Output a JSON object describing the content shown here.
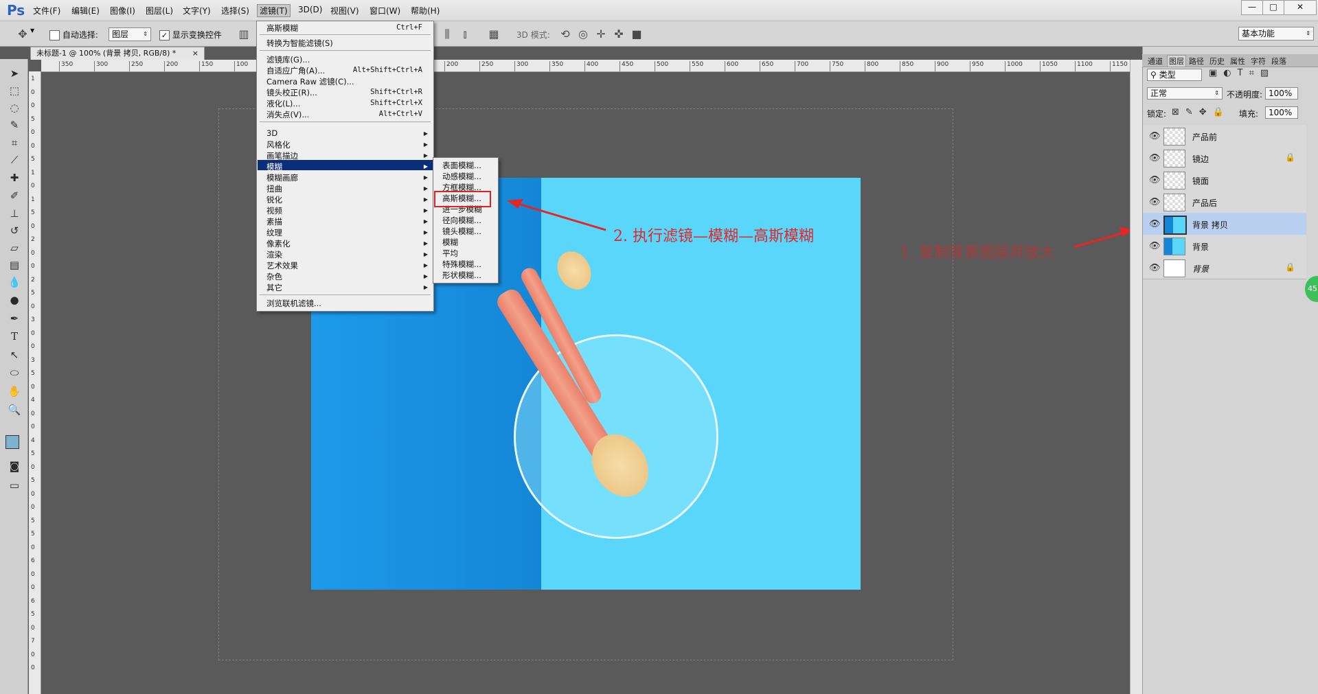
{
  "app": {
    "logo": "Ps",
    "workspace": "基本功能"
  },
  "menubar": {
    "items": [
      "文件(F)",
      "编辑(E)",
      "图像(I)",
      "图层(L)",
      "文字(Y)",
      "选择(S)",
      "滤镜(T)",
      "3D(D)",
      "视图(V)",
      "窗口(W)",
      "帮助(H)"
    ],
    "active": "滤镜(T)"
  },
  "window_controls": {
    "minimize": "—",
    "maximize": "□",
    "close": "✕"
  },
  "options": {
    "auto_select_label": "自动选择:",
    "auto_select_value": "图层",
    "show_transform_label": "显示变换控件",
    "mode_3d_label": "3D 模式:"
  },
  "document": {
    "tab_title": "未标题-1 @ 100% (背景 拷贝, RGB/8) *",
    "tab_close": "×"
  },
  "ruler": {
    "h_labels": [
      "350",
      "300",
      "250",
      "200",
      "150",
      "100",
      "50",
      "0",
      "50",
      "100",
      "150",
      "200",
      "250",
      "300",
      "350",
      "400",
      "450",
      "500",
      "550",
      "600",
      "650",
      "700",
      "750",
      "800",
      "850",
      "900",
      "950",
      "1000",
      "1050",
      "1100",
      "1150"
    ],
    "v_labels": [
      "1",
      "0",
      "0",
      "5",
      "0",
      "0",
      "5",
      "1",
      "0",
      "1",
      "5",
      "0",
      "2",
      "0",
      "0",
      "2",
      "5",
      "0",
      "3",
      "0",
      "0",
      "3",
      "5",
      "0",
      "4",
      "0",
      "0",
      "4",
      "5",
      "0",
      "5",
      "0",
      "0",
      "5",
      "5",
      "0",
      "6",
      "0",
      "0",
      "6",
      "5",
      "0",
      "7",
      "0",
      "0"
    ]
  },
  "filter_menu": {
    "items": [
      {
        "label": "高斯模糊",
        "shortcut": "Ctrl+F"
      },
      {
        "label": "转换为智能滤镜(S)",
        "shortcut": ""
      },
      {
        "label": "滤镜库(G)...",
        "shortcut": ""
      },
      {
        "label": "自适应广角(A)...",
        "shortcut": "Alt+Shift+Ctrl+A"
      },
      {
        "label": "Camera Raw 滤镜(C)...",
        "shortcut": ""
      },
      {
        "label": "镜头校正(R)...",
        "shortcut": "Shift+Ctrl+R"
      },
      {
        "label": "液化(L)...",
        "shortcut": "Shift+Ctrl+X"
      },
      {
        "label": "消失点(V)...",
        "shortcut": "Alt+Ctrl+V"
      },
      {
        "label": "3D",
        "shortcut": ""
      },
      {
        "label": "风格化",
        "shortcut": ""
      },
      {
        "label": "画笔描边",
        "shortcut": ""
      },
      {
        "label": "模糊",
        "shortcut": ""
      },
      {
        "label": "模糊画廊",
        "shortcut": ""
      },
      {
        "label": "扭曲",
        "shortcut": ""
      },
      {
        "label": "锐化",
        "shortcut": ""
      },
      {
        "label": "视频",
        "shortcut": ""
      },
      {
        "label": "素描",
        "shortcut": ""
      },
      {
        "label": "纹理",
        "shortcut": ""
      },
      {
        "label": "像素化",
        "shortcut": ""
      },
      {
        "label": "渲染",
        "shortcut": ""
      },
      {
        "label": "艺术效果",
        "shortcut": ""
      },
      {
        "label": "杂色",
        "shortcut": ""
      },
      {
        "label": "其它",
        "shortcut": ""
      },
      {
        "label": "浏览联机滤镜...",
        "shortcut": ""
      }
    ],
    "highlighted": "模糊"
  },
  "blur_submenu": {
    "items": [
      "表面模糊...",
      "动感模糊...",
      "方框模糊...",
      "高斯模糊...",
      "进一步模糊",
      "径向模糊...",
      "镜头模糊...",
      "模糊",
      "平均",
      "特殊模糊...",
      "形状模糊..."
    ],
    "selected": "高斯模糊..."
  },
  "annotations": {
    "step1": "1. 复制背景图层并放大",
    "step2": "2. 执行滤镜—模糊—高斯模糊"
  },
  "panels": {
    "tabs": [
      "通道",
      "图层",
      "路径",
      "历史",
      "属性",
      "字符",
      "段落"
    ],
    "selected_tab": "图层",
    "filter_kind": "类型",
    "blend_mode": "正常",
    "opacity_label": "不透明度:",
    "opacity_value": "100%",
    "lock_label": "锁定:",
    "fill_label": "填充:",
    "fill_value": "100%"
  },
  "layers": [
    {
      "name": "产品前",
      "locked": false,
      "selected": false,
      "thumb": "checker"
    },
    {
      "name": "镜边",
      "locked": true,
      "selected": false,
      "thumb": "checker"
    },
    {
      "name": "镜面",
      "locked": false,
      "selected": false,
      "thumb": "checker"
    },
    {
      "name": "产品后",
      "locked": false,
      "selected": false,
      "thumb": "checker"
    },
    {
      "name": "背景 拷贝",
      "locked": false,
      "selected": true,
      "thumb": "blue"
    },
    {
      "name": "背景",
      "locked": false,
      "selected": false,
      "thumb": "blue"
    },
    {
      "name": "背景",
      "locked": true,
      "selected": false,
      "thumb": "white"
    }
  ],
  "side_badge": "45",
  "colors": {
    "accent_red": "#e32626",
    "menu_highlight": "#0a2e78",
    "canvas_light": "#5ad6fa",
    "canvas_dark": "#1586d6"
  }
}
